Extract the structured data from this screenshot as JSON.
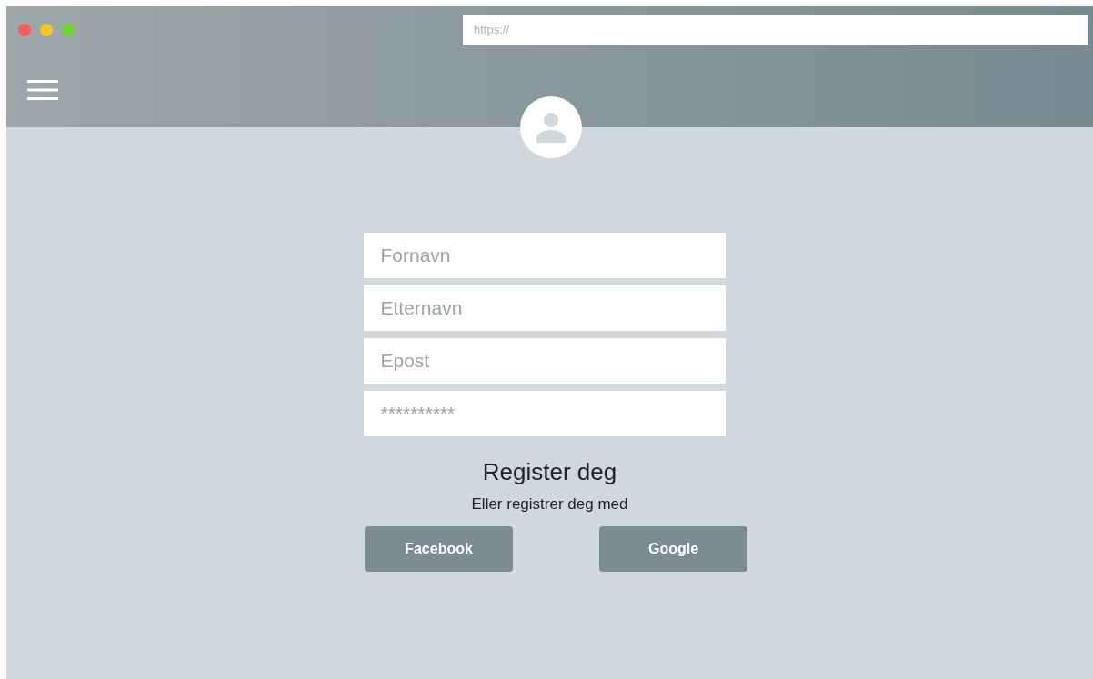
{
  "browser": {
    "window_controls": [
      {
        "color": "#f25f5c"
      },
      {
        "color": "#f7c325"
      },
      {
        "color": "#6fd52b"
      }
    ],
    "address_bar": {
      "placeholder": "https://"
    }
  },
  "form": {
    "fields": [
      {
        "placeholder": "Fornavn"
      },
      {
        "placeholder": "Etternavn"
      },
      {
        "placeholder": "Epost"
      },
      {
        "placeholder": "**********"
      }
    ],
    "title": "Register deg",
    "subtitle": "Eller registrer deg med",
    "buttons": [
      "Facebook",
      "Google"
    ]
  }
}
